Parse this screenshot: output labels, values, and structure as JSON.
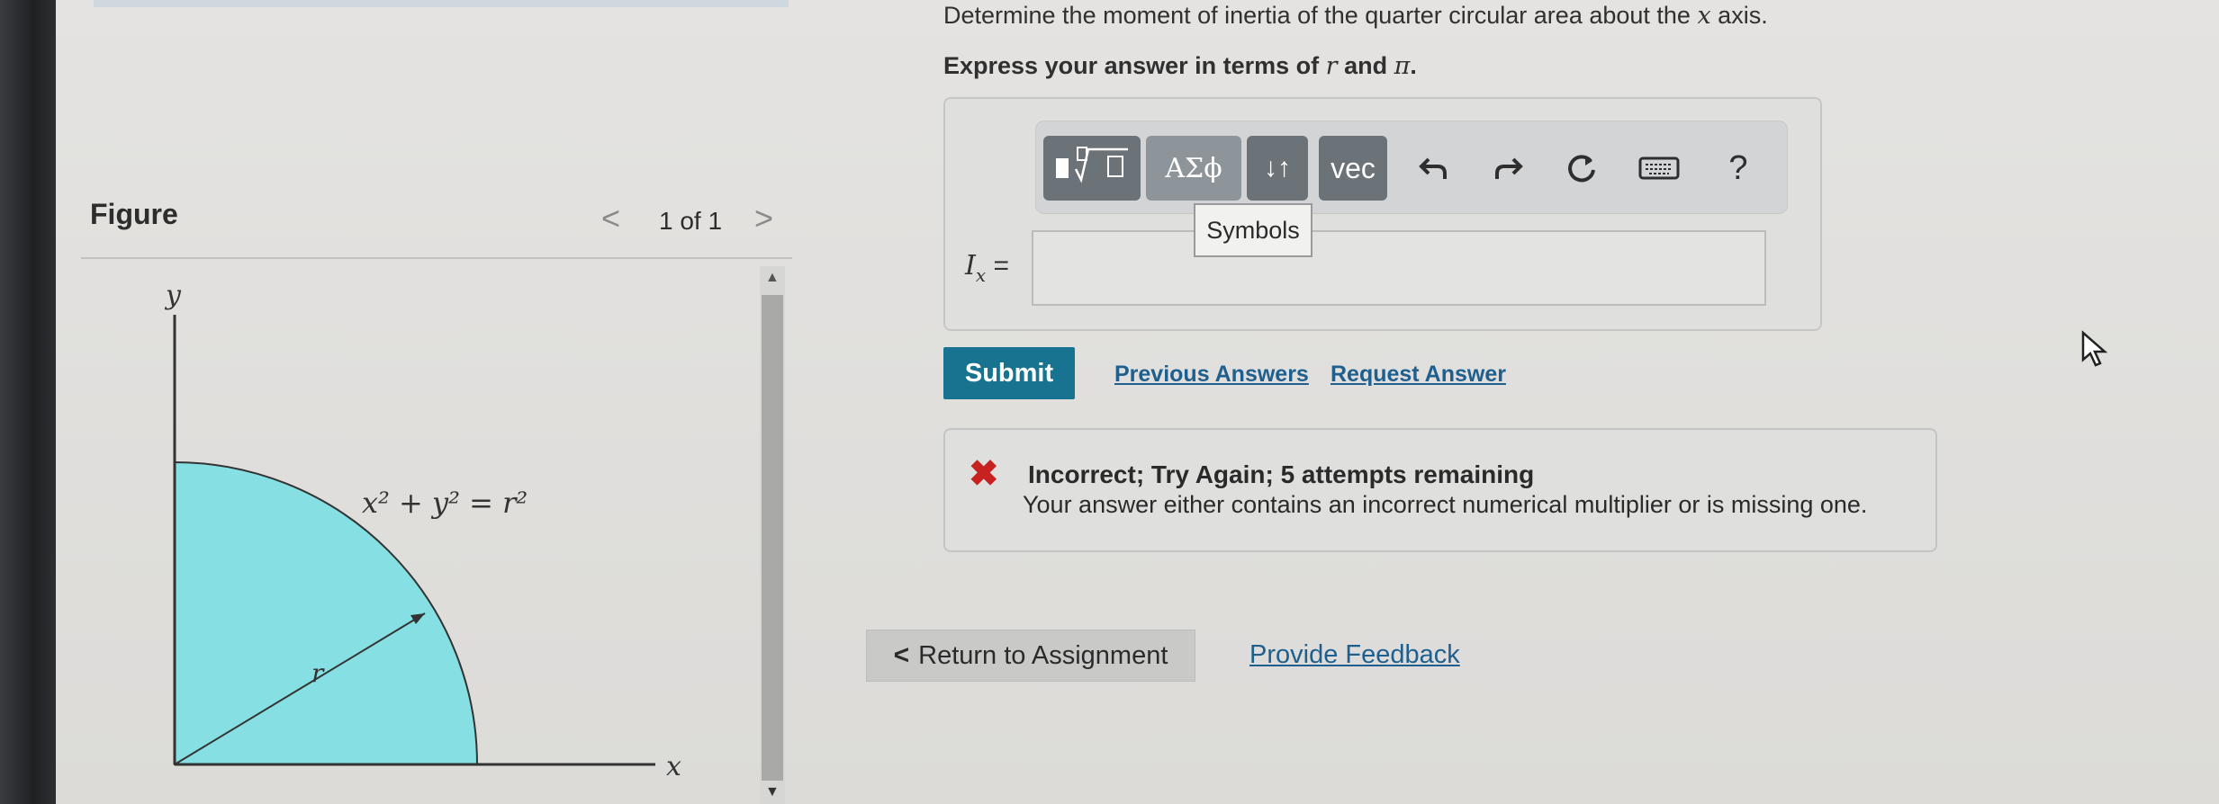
{
  "question": {
    "line1_pre": "Determine the moment of inertia of the quarter circular area about the ",
    "line1_var": "x",
    "line1_post": " axis.",
    "line2_pre": "Express your answer in terms of ",
    "line2_var1": "r",
    "line2_mid": " and ",
    "line2_var2": "π",
    "line2_post": "."
  },
  "toolbar": {
    "templates_icon": "templates-icon",
    "symbols_label": "ΑΣϕ",
    "arrows_label": "↓↑",
    "vec_label": "vec",
    "undo_icon": "undo-icon",
    "redo_icon": "redo-icon",
    "reset_icon": "reset-icon",
    "keyboard_icon": "keyboard-icon",
    "help_label": "?"
  },
  "tooltip": "Symbols",
  "answer": {
    "label_var": "I",
    "label_sub": "x",
    "label_eq": " =",
    "value": ""
  },
  "actions": {
    "submit": "Submit",
    "previous_answers": "Previous Answers",
    "request_answer": "Request Answer"
  },
  "feedback": {
    "title": "Incorrect; Try Again; 5 attempts remaining",
    "message": "Your answer either contains an incorrect numerical multiplier or is missing one."
  },
  "footer": {
    "return": "Return to Assignment",
    "provide_feedback": "Provide Feedback"
  },
  "figure": {
    "title": "Figure",
    "pager": "1 of 1",
    "axis_y": "y",
    "axis_x": "x",
    "radius_label": "r",
    "equation": "x² + y² = r²",
    "fill_color": "#86e0e3"
  },
  "colors": {
    "submit_bg": "#17738f",
    "link": "#1e5f8e",
    "error": "#c7221f"
  }
}
